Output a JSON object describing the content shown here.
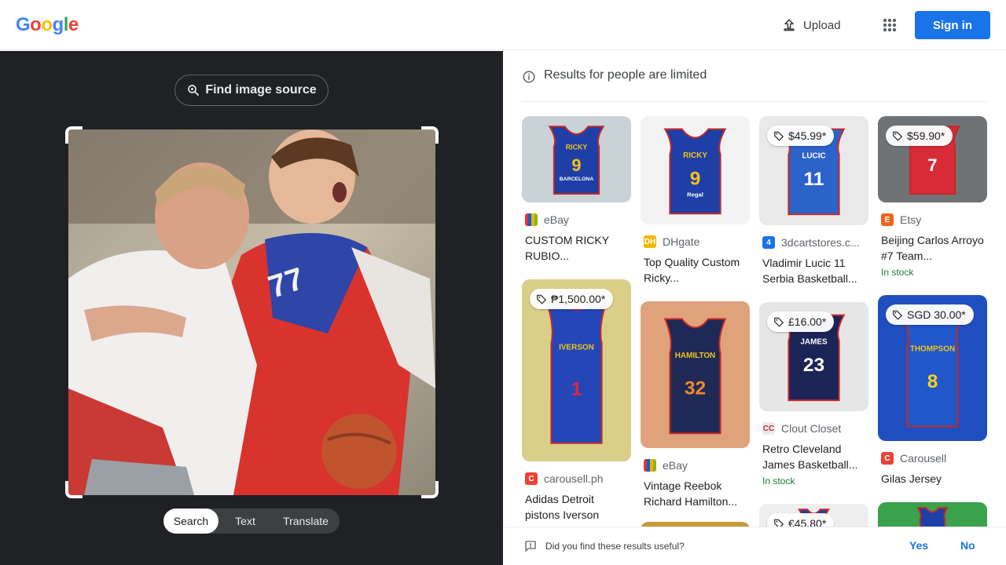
{
  "header": {
    "logo_letters": [
      {
        "ch": "G",
        "color": "#4285F4"
      },
      {
        "ch": "o",
        "color": "#EA4335"
      },
      {
        "ch": "o",
        "color": "#FBBC05"
      },
      {
        "ch": "g",
        "color": "#4285F4"
      },
      {
        "ch": "l",
        "color": "#34A853"
      },
      {
        "ch": "e",
        "color": "#EA4335"
      }
    ],
    "upload_label": "Upload",
    "signin_label": "Sign in"
  },
  "left": {
    "find_source_label": "Find image source",
    "modes": [
      "Search",
      "Text",
      "Translate"
    ],
    "active_mode": "Search"
  },
  "right": {
    "notice": "Results for people are limited",
    "results": [
      {
        "source": "eBay",
        "title": "CUSTOM RICKY RUBIO...",
        "price": "",
        "stock": "",
        "icon_color": "#e53238",
        "icon_text": "",
        "jersey_color": "#1e3fa6",
        "jersey_name": "RICKY",
        "jersey_num": "9",
        "jersey_sub": "BARCELONA",
        "bg": "#c9d3d6",
        "num_color": "#f2c21b"
      },
      {
        "source": "DHgate",
        "title": "Top Quality Custom Ricky...",
        "price": "",
        "stock": "",
        "icon_color": "#f4b400",
        "icon_text": "DH",
        "jersey_color": "#1e3fa6",
        "jersey_name": "RICKY",
        "jersey_num": "9",
        "jersey_sub": "Regal",
        "bg": "#f3f3f3",
        "num_color": "#f2c21b"
      },
      {
        "source": "3dcartstores.c...",
        "title": "Vladimir Lucic 11 Serbia Basketball...",
        "price": "$45.99*",
        "stock": "",
        "icon_color": "#1a73e8",
        "icon_text": "4",
        "jersey_color": "#2c63c9",
        "jersey_name": "LUCIC",
        "jersey_num": "11",
        "jersey_sub": "",
        "bg": "#e9e9e9",
        "num_color": "#ffffff"
      },
      {
        "source": "Etsy",
        "title": "Beijing Carlos Arroyo #7 Team...",
        "price": "$59.90*",
        "stock": "In stock",
        "icon_color": "#f1641e",
        "icon_text": "E",
        "jersey_color": "#d62b36",
        "jersey_name": "",
        "jersey_num": "7",
        "jersey_sub": "",
        "bg": "#6f7376",
        "num_color": "#ffffff"
      },
      {
        "source": "carousell.ph",
        "title": "Adidas Detroit pistons Iverson",
        "price": "₱1,500.00*",
        "stock": "",
        "icon_color": "#ea4335",
        "icon_text": "C",
        "jersey_color": "#2446b8",
        "jersey_name": "IVERSON",
        "jersey_num": "1",
        "jersey_sub": "",
        "bg": "#d9cf88",
        "num_color": "#e0293b"
      },
      {
        "source": "eBay",
        "title": "Vintage Reebok Richard Hamilton...",
        "price": "",
        "stock": "",
        "icon_color": "#e53238",
        "icon_text": "",
        "jersey_color": "#1e2a55",
        "jersey_name": "HAMILTON",
        "jersey_num": "32",
        "jersey_sub": "",
        "bg": "#e0a27a",
        "num_color": "#f08a2b"
      },
      {
        "source": "Clout Closet",
        "title": "Retro Cleveland James Basketball...",
        "price": "£16.00*",
        "stock": "In stock",
        "icon_color": "#e8ebee",
        "icon_text": "CC",
        "jersey_color": "#1a2457",
        "jersey_name": "JAMES",
        "jersey_num": "23",
        "jersey_sub": "",
        "bg": "#e6e6e6",
        "num_color": "#ffffff"
      },
      {
        "source": "Carousell",
        "title": "Gilas Jersey",
        "price": "SGD 30.00*",
        "stock": "",
        "icon_color": "#ea4335",
        "icon_text": "C",
        "jersey_color": "#2157c9",
        "jersey_name": "THOMPSON",
        "jersey_num": "8",
        "jersey_sub": "",
        "bg": "#1f4fbf",
        "num_color": "#f6d21d"
      },
      {
        "source": "",
        "title": "",
        "price": "",
        "stock": "",
        "icon_color": "#e53238",
        "icon_text": "",
        "jersey_color": "#b08a2c",
        "jersey_name": "",
        "jersey_num": "",
        "jersey_sub": "",
        "bg": "#c59a3a",
        "num_color": "#ffffff"
      },
      {
        "source": "",
        "title": "",
        "price": "€45.80*",
        "stock": "",
        "icon_color": "#e53238",
        "icon_text": "",
        "jersey_color": "#1e3fa6",
        "jersey_name": "",
        "jersey_num": "",
        "jersey_sub": "",
        "bg": "#eeeeee",
        "num_color": "#ffffff"
      },
      {
        "source": "",
        "title": "",
        "price": "",
        "stock": "",
        "icon_color": "#e53238",
        "icon_text": "",
        "jersey_color": "#1e3fa6",
        "jersey_name": "",
        "jersey_num": "",
        "jersey_sub": "",
        "bg": "#3aa24a",
        "num_color": "#ffffff"
      }
    ],
    "feedback_question": "Did you find these results useful?",
    "feedback_yes": "Yes",
    "feedback_no": "No"
  }
}
